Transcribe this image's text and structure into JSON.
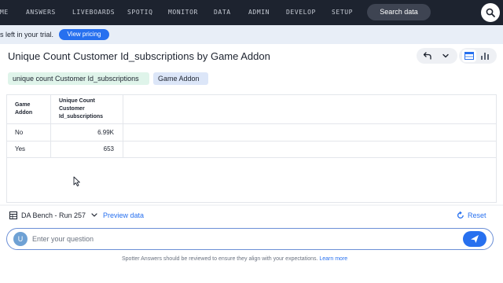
{
  "nav": {
    "items": [
      "ME",
      "ANSWERS",
      "LIVEBOARDS",
      "SPOTIQ",
      "MONITOR",
      "DATA",
      "ADMIN",
      "DEVELOP",
      "SETUP"
    ],
    "search_label": "Search data",
    "search_icon": "search-icon"
  },
  "trial": {
    "text": "s left in your trial.",
    "pricing_label": "View pricing"
  },
  "answer": {
    "title": "Unique Count Customer Id_subscriptions by Game Addon",
    "chips": {
      "measure": "unique count Customer Id_subscriptions",
      "attribute": "Game Addon"
    },
    "table": {
      "headers": [
        "Game Addon",
        "Unique Count Customer Id_subscriptions"
      ],
      "rows": [
        [
          "No",
          "6.99K"
        ],
        [
          "Yes",
          "653"
        ]
      ]
    }
  },
  "bottom": {
    "datasource": "DA Bench - Run 257",
    "preview_label": "Preview data",
    "reset_label": "Reset",
    "avatar_letter": "U",
    "question_placeholder": "Enter your question",
    "disclaimer": "Spotter Answers should be reviewed to ensure they align with your expectations.",
    "learn_more": "Learn more"
  },
  "colors": {
    "nav_bg": "#1d232f",
    "accent": "#2770ef",
    "measure_chip": "#dff4ea",
    "attribute_chip": "#dce6f8"
  }
}
